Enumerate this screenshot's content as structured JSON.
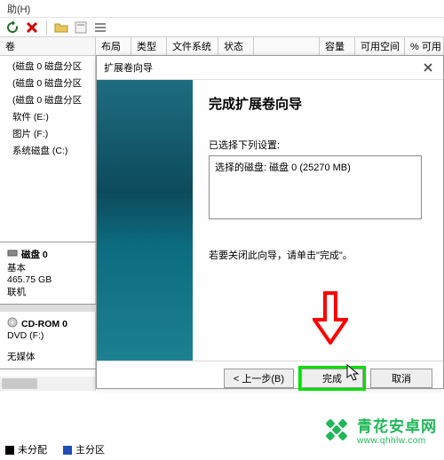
{
  "menubar": {
    "help": "助(H)"
  },
  "toolbar": {
    "icons": [
      "refresh-icon",
      "close-icon",
      "sep",
      "folder-icon",
      "props-icon",
      "views-icon"
    ]
  },
  "tree": {
    "header": "卷",
    "items": [
      "(磁盘 0 磁盘分区 ",
      "(磁盘 0 磁盘分区 ",
      "(磁盘 0 磁盘分区 ",
      "软件 (E:)",
      "图片 (F:)",
      "系统磁盘 (C:)"
    ]
  },
  "columns": [
    "布局",
    "类型",
    "文件系统",
    "状态",
    "容量",
    "可用空间",
    "% 可用"
  ],
  "disk_panel": [
    {
      "name": "磁盘 0",
      "type": "基本",
      "size": "465.75 GB",
      "status": "联机",
      "icon": "disk-icon"
    },
    {
      "name": "CD-ROM 0",
      "type": "DVD (F:)",
      "size": "",
      "status": "无媒体",
      "icon": "cdrom-icon"
    }
  ],
  "legend": {
    "unallocated": "未分配",
    "primary": "主分区"
  },
  "wizard": {
    "title": "扩展卷向导",
    "heading": "完成扩展卷向导",
    "selected_label": "已选择下列设置:",
    "selected_value": "选择的磁盘: 磁盘 0 (25270 MB)",
    "hint": "若要关闭此向导，请单击\"完成\"。",
    "buttons": {
      "back": "< 上一步(B)",
      "finish": "完成",
      "cancel": "取消"
    }
  },
  "watermark": {
    "cn": "青花安卓网",
    "url": "www.qhhlw.com"
  }
}
